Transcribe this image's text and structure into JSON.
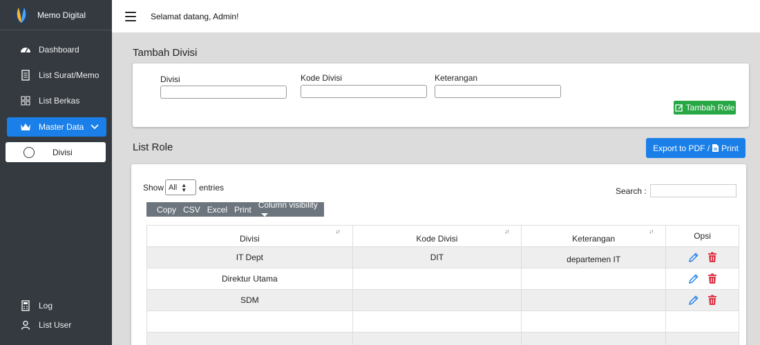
{
  "app": {
    "name": "Memo Digital"
  },
  "sidebar": {
    "items": [
      {
        "label": "Dashboard",
        "icon": "dashboard-icon"
      },
      {
        "label": "List Surat/Memo",
        "icon": "document-icon"
      },
      {
        "label": "List Berkas",
        "icon": "grid-icon"
      },
      {
        "label": "Master Data",
        "icon": "crown-icon",
        "active": true
      },
      {
        "label": "Divisi",
        "icon": "circle-icon"
      },
      {
        "label": "Log",
        "icon": "log-icon"
      },
      {
        "label": "List User",
        "icon": "user-icon"
      }
    ]
  },
  "topbar": {
    "welcome": "Selamat datang, Admin!"
  },
  "form": {
    "title": "Tambah Divisi",
    "fields": [
      {
        "label": "Divisi",
        "value": ""
      },
      {
        "label": "Kode Divisi",
        "value": ""
      },
      {
        "label": "Keterangan",
        "value": ""
      }
    ],
    "submit_label": "Tambah Role"
  },
  "list": {
    "title": "List Role",
    "export_label": "Export to PDF / ",
    "print_label": "Print",
    "show_label": "Show",
    "show_value": "All",
    "entries_label": "entries",
    "search_label": "Search :",
    "search_value": "",
    "buttons": [
      "Copy",
      "CSV",
      "Excel",
      "Print",
      "Column visibility"
    ],
    "columns": [
      "Divisi",
      "Kode Divisi",
      "Keterangan",
      "Opsi"
    ],
    "rows": [
      {
        "divisi": "IT Dept",
        "kode": "DIT",
        "keterangan": "departemen IT"
      },
      {
        "divisi": "Direktur Utama",
        "kode": "",
        "keterangan": ""
      },
      {
        "divisi": "SDM",
        "kode": "",
        "keterangan": ""
      }
    ]
  },
  "colors": {
    "primary": "#1a7fe8",
    "success": "#28a745",
    "danger": "#dc3545",
    "sidebar": "#343a40"
  }
}
